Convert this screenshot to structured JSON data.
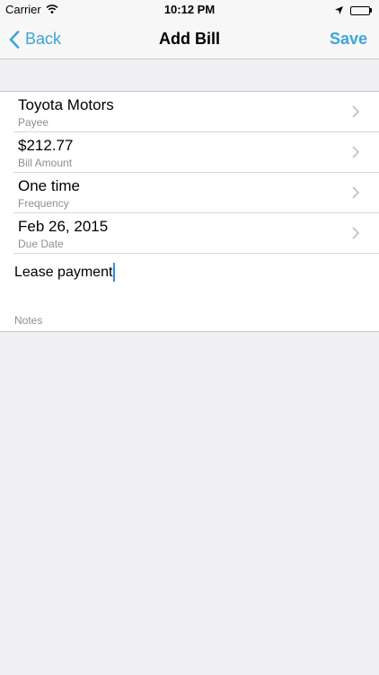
{
  "status_bar": {
    "carrier": "Carrier",
    "time": "10:12 PM",
    "icons": [
      "wifi-icon",
      "location-arrow-icon",
      "battery-icon"
    ]
  },
  "nav": {
    "back_label": "Back",
    "title": "Add Bill",
    "save_label": "Save"
  },
  "form": {
    "rows": [
      {
        "value": "Toyota Motors",
        "label": "Payee"
      },
      {
        "value": "$212.77",
        "label": "Bill Amount"
      },
      {
        "value": "One time",
        "label": "Frequency"
      },
      {
        "value": "Feb 26, 2015",
        "label": "Due Date"
      }
    ],
    "notes": {
      "value": "Lease payment",
      "label": "Notes"
    }
  },
  "colors": {
    "accent": "#3aa6d8",
    "background": "#efeff4",
    "secondary_text": "#8e8e93"
  }
}
